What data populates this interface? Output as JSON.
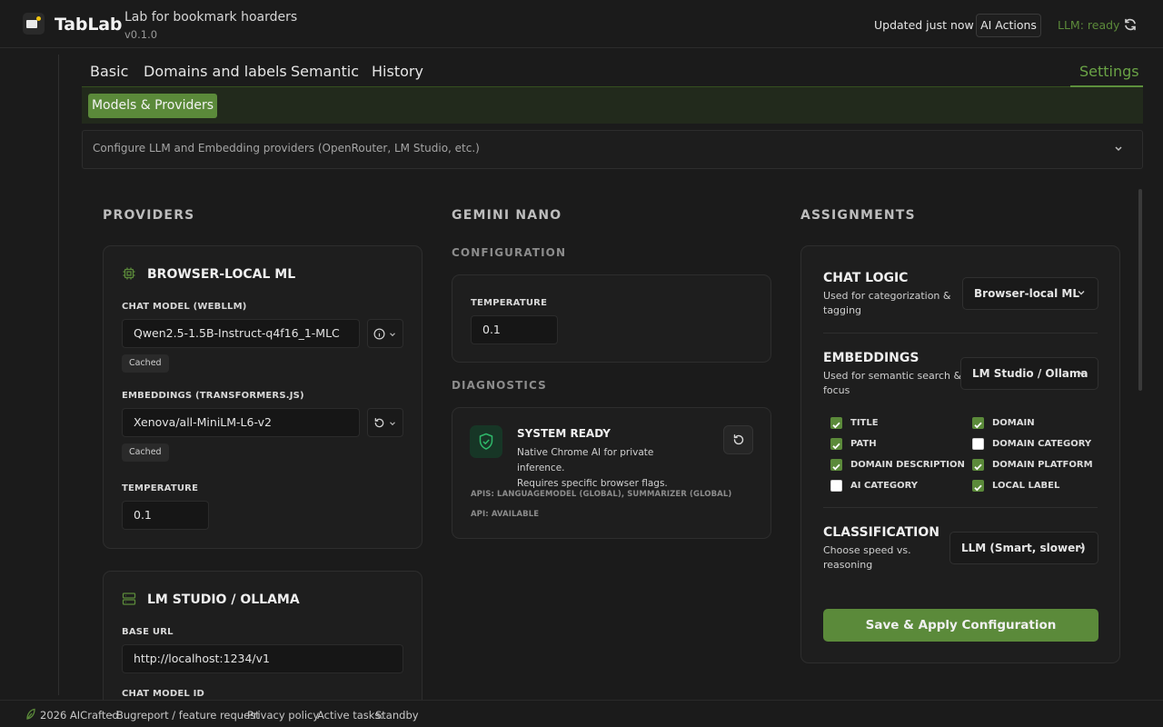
{
  "app": {
    "name": "TabLab",
    "subtitle": "Lab for bookmark hoarders",
    "version": "v0.1.0",
    "updated": "Updated just now",
    "ai_actions": "AI Actions",
    "llm_status": "LLM: ready"
  },
  "nav": {
    "tabs": [
      "Basic",
      "Domains and labels",
      "Semantic",
      "History"
    ],
    "settings": "Settings"
  },
  "subnav": {
    "active": "Models & Providers"
  },
  "accordion": {
    "text": "Configure LLM and Embedding providers (OpenRouter, LM Studio, etc.)"
  },
  "providers": {
    "heading": "PROVIDERS",
    "browser_local": {
      "title": "BROWSER-LOCAL ML",
      "chat_model_label": "CHAT MODEL (WEBLLM)",
      "chat_model_value": "Qwen2.5-1.5B-Instruct-q4f16_1-MLC",
      "chat_model_status": "Cached",
      "embeddings_label": "EMBEDDINGS (TRANSFORMERS.JS)",
      "embeddings_value": "Xenova/all-MiniLM-L6-v2",
      "embeddings_status": "Cached",
      "temperature_label": "TEMPERATURE",
      "temperature_value": "0.1"
    },
    "lm_studio": {
      "title": "LM STUDIO / OLLAMA",
      "base_url_label": "BASE URL",
      "base_url_value": "http://localhost:1234/v1",
      "chat_model_id_label": "CHAT MODEL ID"
    }
  },
  "gemini": {
    "heading": "GEMINI NANO",
    "config_heading": "CONFIGURATION",
    "temperature_label": "TEMPERATURE",
    "temperature_value": "0.1",
    "diag_heading": "DIAGNOSTICS",
    "status_title": "SYSTEM READY",
    "status_desc_1": "Native Chrome AI for private inference.",
    "status_desc_2": "Requires specific browser flags.",
    "apis": "APIS: LANGUAGEMODEL (GLOBAL), SUMMARIZER (GLOBAL)",
    "api_status": "API: AVAILABLE"
  },
  "assignments": {
    "heading": "ASSIGNMENTS",
    "chat_logic": {
      "title": "CHAT LOGIC",
      "desc_1": "Used for categorization &",
      "desc_2": "tagging",
      "value": "Browser-local ML"
    },
    "embeddings": {
      "title": "EMBEDDINGS",
      "desc_1": "Used for semantic search &",
      "desc_2": "focus",
      "value": "LM Studio / Ollama"
    },
    "checkboxes": [
      {
        "label": "TITLE",
        "checked": true
      },
      {
        "label": "DOMAIN",
        "checked": true
      },
      {
        "label": "PATH",
        "checked": true
      },
      {
        "label": "DOMAIN CATEGORY",
        "checked": false
      },
      {
        "label": "DOMAIN DESCRIPTION",
        "checked": true
      },
      {
        "label": "DOMAIN PLATFORM",
        "checked": true
      },
      {
        "label": "AI CATEGORY",
        "checked": false
      },
      {
        "label": "LOCAL LABEL",
        "checked": true
      }
    ],
    "classification": {
      "title": "CLASSIFICATION",
      "desc_1": "Choose speed vs.",
      "desc_2": "reasoning",
      "value": "LLM (Smart, slower)"
    },
    "save": "Save & Apply Configuration"
  },
  "footer": {
    "copyright": "2026 AICrafted",
    "sep": "·",
    "bugreport": "Bugreport / feature request",
    "privacy": "Privacy policy",
    "tasks_label": "Active tasks:",
    "tasks_value": "Standby"
  },
  "colors": {
    "accent": "#5b8a3a",
    "accent_text": "#6aa346",
    "bg": "#1b1b1b"
  }
}
